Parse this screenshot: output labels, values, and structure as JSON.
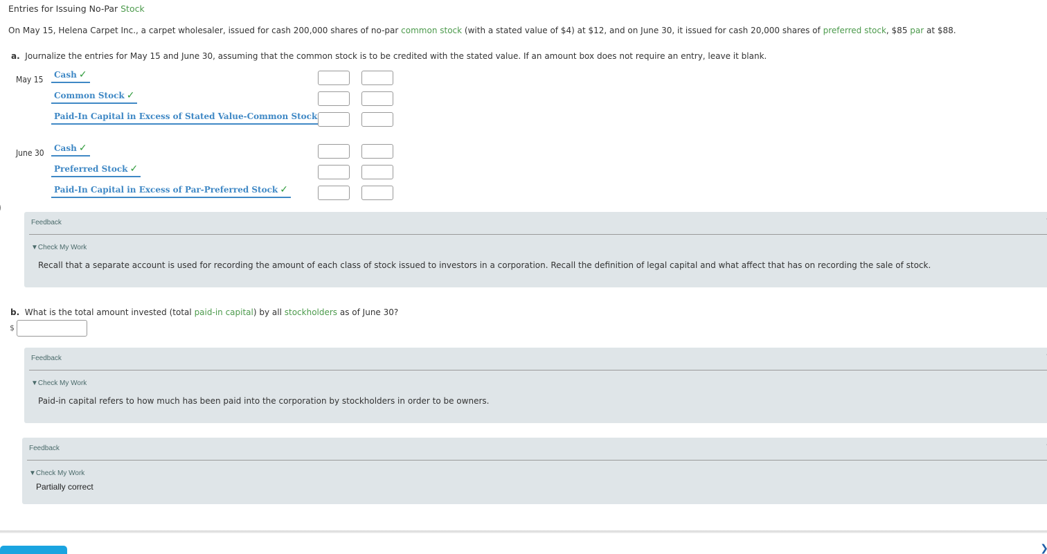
{
  "header": {
    "title_prefix": "Entries for Issuing No-Par ",
    "title_link": "Stock"
  },
  "intro": {
    "p1": "On May 15, Helena Carpet Inc., a carpet wholesaler, issued for cash 200,000 shares of no-par ",
    "l1": "common stock",
    "p2": " (with a stated value of $4) at $12, and on June 30, it issued for cash 20,000 shares of ",
    "l2": "preferred stock",
    "p3": ", $85 ",
    "l3": "par",
    "p4": " at $88."
  },
  "part_a": {
    "label": "a.",
    "question": "Journalize the entries for May 15 and June 30, assuming that the common stock is to be credited with the stated value. If an amount box does not require an entry, leave it blank.",
    "entries": [
      {
        "date": "May 15",
        "lines": [
          {
            "account": "Cash",
            "status": "correct",
            "debit": "",
            "credit": ""
          },
          {
            "account": "Common Stock",
            "status": "correct",
            "debit": "",
            "credit": ""
          },
          {
            "account": "Paid-In Capital in Excess of Stated Value-Common Stock",
            "status": "correct",
            "debit": "",
            "credit": ""
          }
        ]
      },
      {
        "date": "June 30",
        "lines": [
          {
            "account": "Cash",
            "status": "correct",
            "debit": "",
            "credit": ""
          },
          {
            "account": "Preferred Stock",
            "status": "correct",
            "debit": "",
            "credit": ""
          },
          {
            "account": "Paid-In Capital in Excess of Par-Preferred Stock",
            "status": "correct",
            "debit": "",
            "credit": ""
          }
        ]
      }
    ],
    "check_icon": "checkmark-icon",
    "feedback": {
      "heading": "Feedback",
      "toggle": "Check My Work",
      "body": "Recall that a separate account is used for recording the amount of each class of stock issued to investors in a corporation. Recall the definition of legal capital and what affect that has on recording the sale of stock."
    }
  },
  "part_b": {
    "label": "b.",
    "q1": "What is the total amount invested (total ",
    "l1": "paid-in capital",
    "q2": ") by all ",
    "l2": "stockholders",
    "q3": " as of June 30?",
    "currency": "$",
    "value": "",
    "feedback": {
      "heading": "Feedback",
      "toggle": "Check My Work",
      "body": "Paid-in capital refers to how much has been paid into the corporation by stockholders in order to be owners."
    }
  },
  "overall_feedback": {
    "heading": "Feedback",
    "toggle": "Check My Work",
    "body": "Partially correct"
  },
  "glyphs": {
    "check": "✓",
    "triangle": "▼"
  },
  "colors": {
    "link_green": "#4c9a4c",
    "account_blue": "#3f88c5",
    "check_green": "#2e9a3a",
    "feedback_bg": "#dfe5e8"
  }
}
